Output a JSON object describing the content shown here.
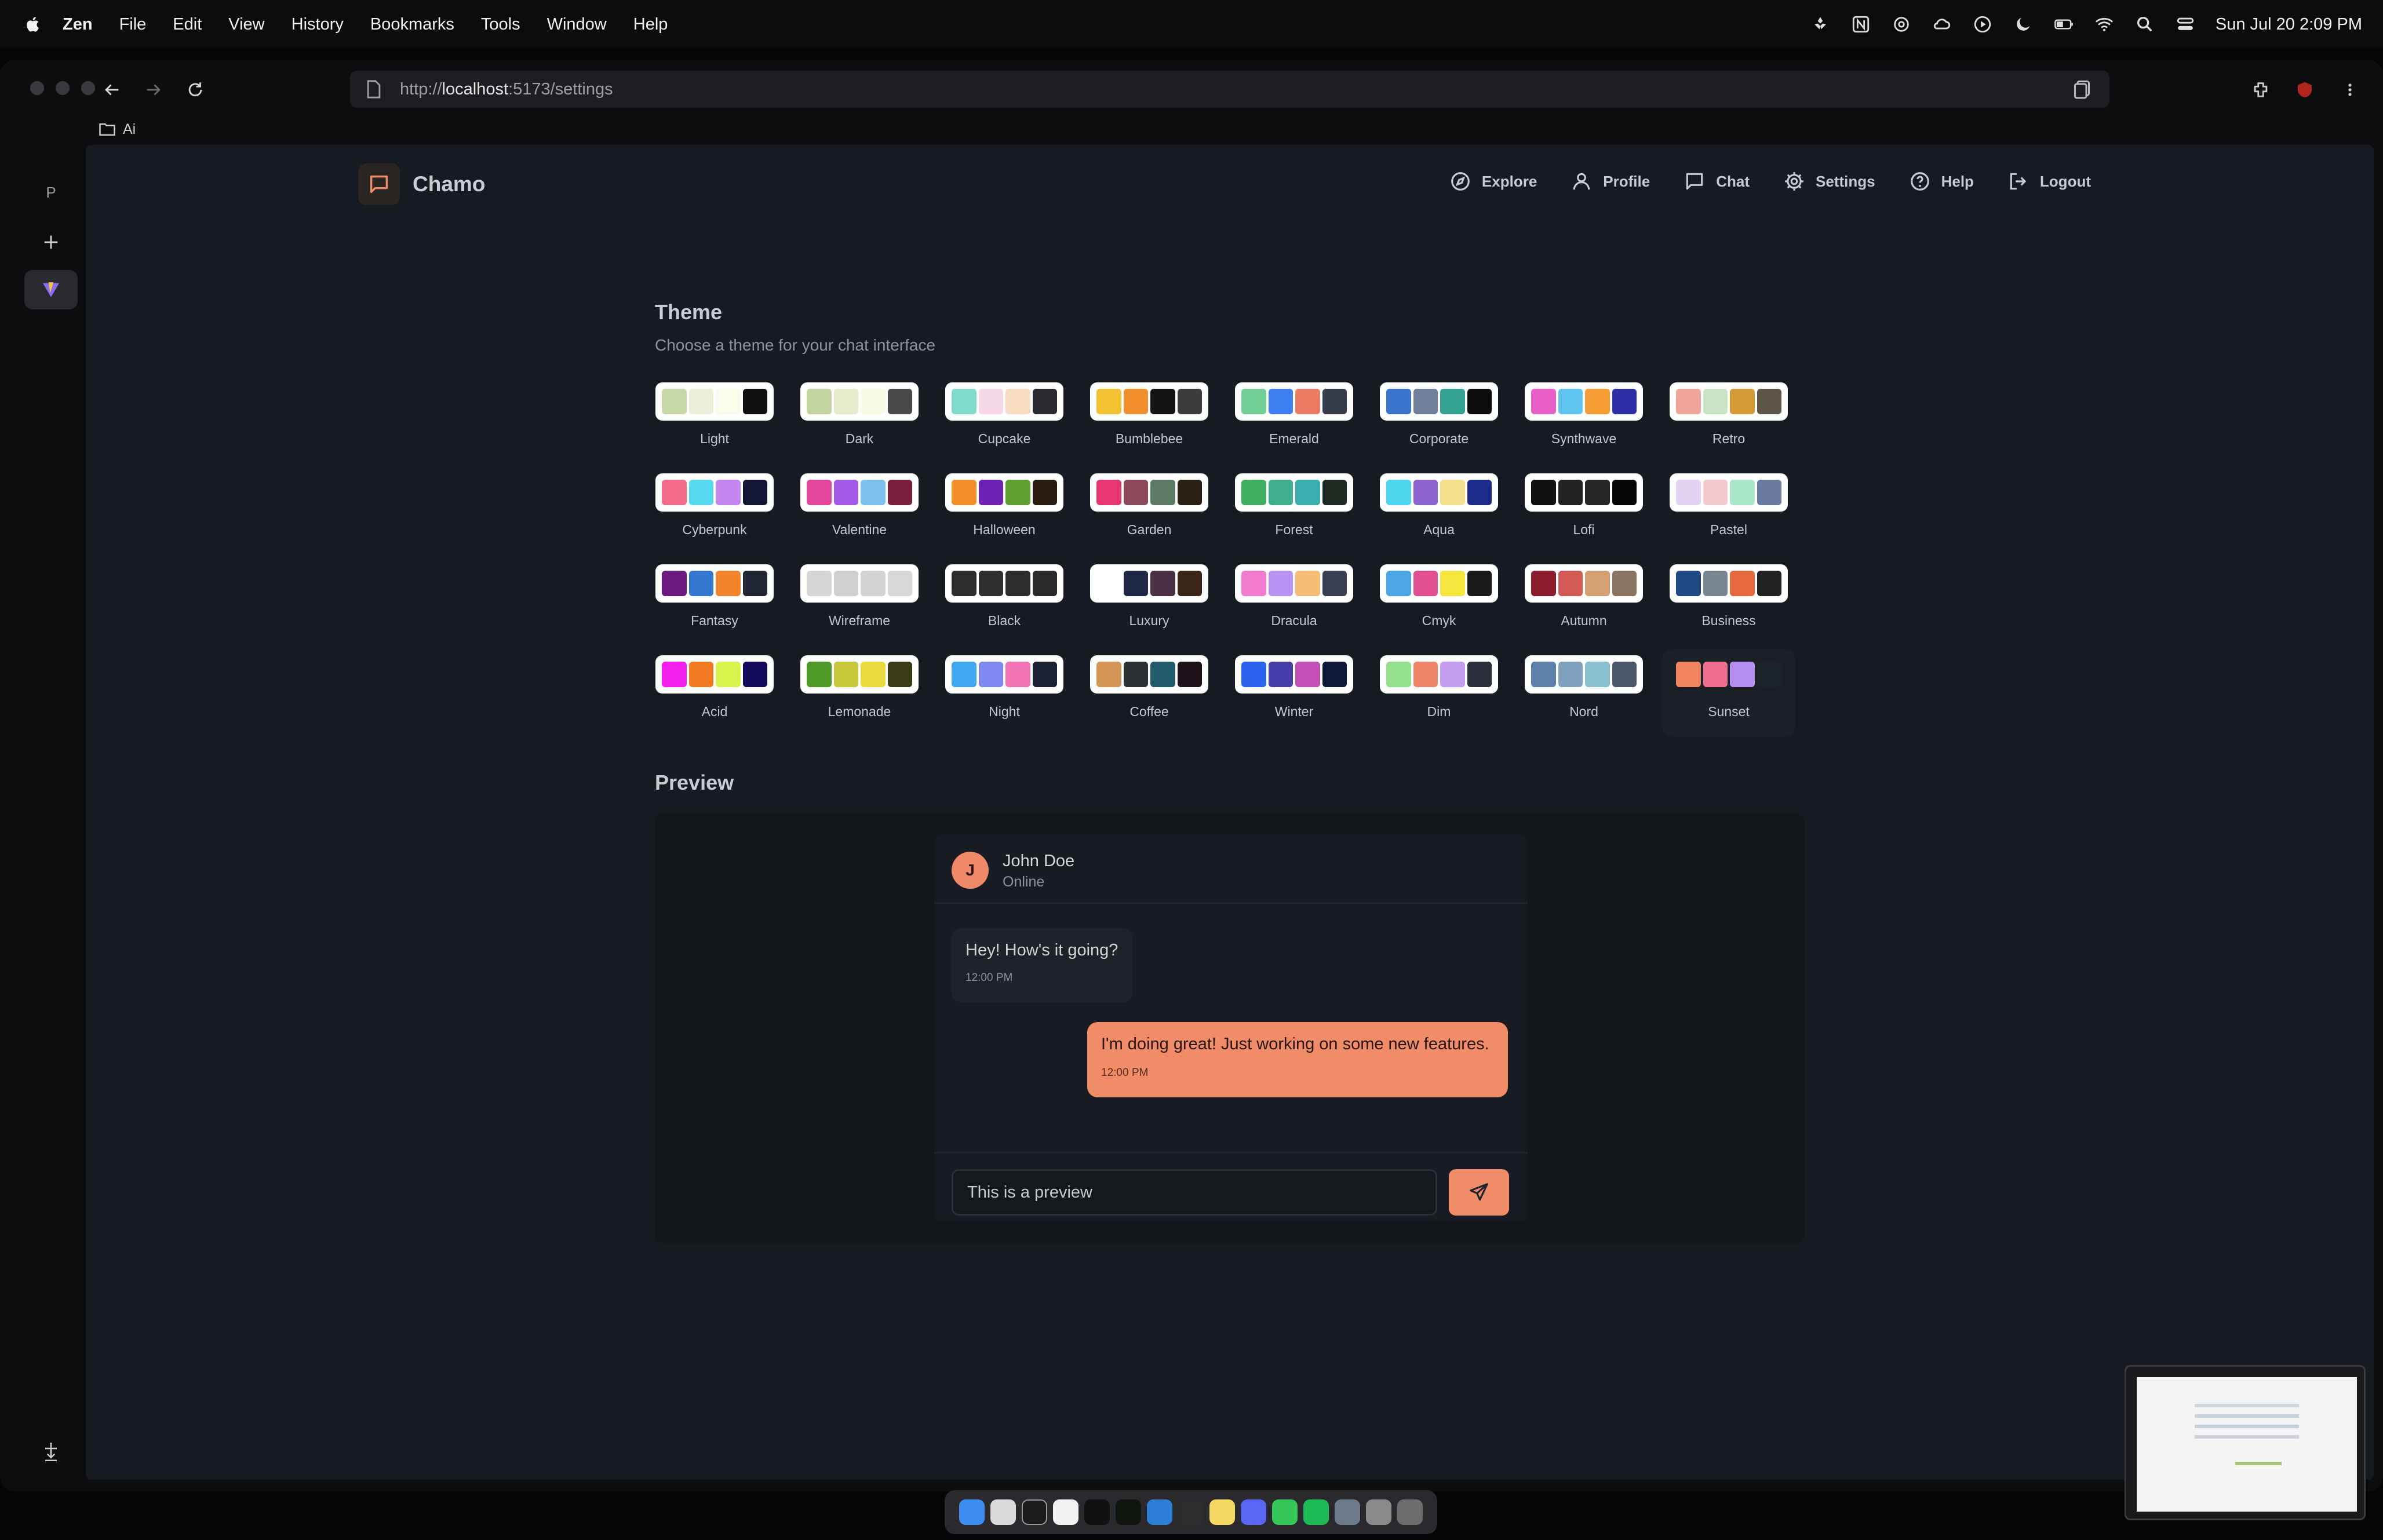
{
  "menubar": {
    "app": "Zen",
    "items": [
      "File",
      "Edit",
      "View",
      "History",
      "Bookmarks",
      "Tools",
      "Window",
      "Help"
    ],
    "clock": "Sun Jul 20  2:09 PM"
  },
  "browser": {
    "url_prefix": "http://",
    "url_host": "localhost",
    "url_path": ":5173/settings",
    "bookmark": "Ai",
    "strip_letter": "P"
  },
  "app": {
    "brand": "Chamo",
    "nav": [
      {
        "label": "Explore",
        "icon": "compass-icon"
      },
      {
        "label": "Profile",
        "icon": "user-icon"
      },
      {
        "label": "Chat",
        "icon": "chat-icon"
      },
      {
        "label": "Settings",
        "icon": "gear-icon"
      },
      {
        "label": "Help",
        "icon": "help-icon"
      },
      {
        "label": "Logout",
        "icon": "logout-icon"
      }
    ]
  },
  "theme": {
    "title": "Theme",
    "subtitle": "Choose a theme for your chat interface",
    "selected": "Sunset",
    "themes": [
      {
        "name": "Light",
        "colors": [
          "#c7d9a6",
          "#e9efd9",
          "#f7fbe9",
          "#111111"
        ]
      },
      {
        "name": "Dark",
        "colors": [
          "#c3d4a0",
          "#e3ebcb",
          "#f7fae4",
          "#4a4a4a"
        ]
      },
      {
        "name": "Cupcake",
        "colors": [
          "#7fdccb",
          "#f6d7e6",
          "#f8dcbf",
          "#2b2b2f"
        ]
      },
      {
        "name": "Bumblebee",
        "colors": [
          "#f2c132",
          "#f08f2c",
          "#141414",
          "#3c3c3c"
        ]
      },
      {
        "name": "Emerald",
        "colors": [
          "#6fcf94",
          "#3d7ff0",
          "#ec7b61",
          "#343b4a"
        ]
      },
      {
        "name": "Corporate",
        "colors": [
          "#3b74cf",
          "#6f7f97",
          "#34a290",
          "#0c0c0c"
        ]
      },
      {
        "name": "Synthwave",
        "colors": [
          "#ea5fc7",
          "#5fc3f2",
          "#f39d34",
          "#2c2fa8"
        ]
      },
      {
        "name": "Retro",
        "colors": [
          "#f0a49a",
          "#c9e3c4",
          "#d49933",
          "#5d5647"
        ]
      },
      {
        "name": "Cyberpunk",
        "colors": [
          "#f36c8a",
          "#57d9ef",
          "#c585ee",
          "#121633"
        ]
      },
      {
        "name": "Valentine",
        "colors": [
          "#e1479b",
          "#a45ae8",
          "#7fc1ee",
          "#7a1e3d"
        ]
      },
      {
        "name": "Halloween",
        "colors": [
          "#f28f2a",
          "#6f22b3",
          "#5f9f30",
          "#2b1c12"
        ]
      },
      {
        "name": "Garden",
        "colors": [
          "#e63571",
          "#8a4a5a",
          "#5d7a64",
          "#2a2013"
        ]
      },
      {
        "name": "Forest",
        "colors": [
          "#3fae5f",
          "#3fae8c",
          "#3aaeae",
          "#1f2a22"
        ]
      },
      {
        "name": "Aqua",
        "colors": [
          "#4ed6ee",
          "#8e63cf",
          "#f4e08c",
          "#1c2a8a"
        ]
      },
      {
        "name": "Lofi",
        "colors": [
          "#111111",
          "#222222",
          "#262626",
          "#050505"
        ]
      },
      {
        "name": "Pastel",
        "colors": [
          "#e4d2f5",
          "#f4c8cf",
          "#a9e6ca",
          "#6b7aa0"
        ]
      },
      {
        "name": "Fantasy",
        "colors": [
          "#6b1a80",
          "#3478d1",
          "#f2842d",
          "#1f2533"
        ]
      },
      {
        "name": "Wireframe",
        "colors": [
          "#d6d6d6",
          "#d0d0d0",
          "#d3d3d3",
          "#d8d8d8"
        ]
      },
      {
        "name": "Black",
        "colors": [
          "#2e2e2e",
          "#303030",
          "#2c2c2c",
          "#2a2a2a"
        ]
      },
      {
        "name": "Luxury",
        "colors": [
          "#ffffff",
          "#1e2844",
          "#4b2f45",
          "#3a2618"
        ]
      },
      {
        "name": "Dracula",
        "colors": [
          "#f07bcf",
          "#b993f2",
          "#f4bd76",
          "#3a3e52"
        ]
      },
      {
        "name": "Cmyk",
        "colors": [
          "#4aa6e4",
          "#e2508f",
          "#f5e53f",
          "#1a1a1a"
        ]
      },
      {
        "name": "Autumn",
        "colors": [
          "#8c1d2c",
          "#d35a54",
          "#d3a071",
          "#8a735f"
        ]
      },
      {
        "name": "Business",
        "colors": [
          "#1e4a83",
          "#7a8593",
          "#e4693f",
          "#222222"
        ]
      },
      {
        "name": "Acid",
        "colors": [
          "#f51ff0",
          "#f17a23",
          "#d8f34b",
          "#130a5c"
        ]
      },
      {
        "name": "Lemonade",
        "colors": [
          "#4e9a28",
          "#c6c639",
          "#ecd93d",
          "#3a3a16"
        ]
      },
      {
        "name": "Night",
        "colors": [
          "#3fa8f1",
          "#7e86ef",
          "#f271b3",
          "#1b2133"
        ]
      },
      {
        "name": "Coffee",
        "colors": [
          "#d49555",
          "#2b3135",
          "#225b6b",
          "#1c1219"
        ]
      },
      {
        "name": "Winter",
        "colors": [
          "#2b63ee",
          "#463ea8",
          "#c24fb6",
          "#0c1838"
        ]
      },
      {
        "name": "Dim",
        "colors": [
          "#93e08e",
          "#f1856a",
          "#c69cf0",
          "#2a2f3b"
        ]
      },
      {
        "name": "Nord",
        "colors": [
          "#5e81ac",
          "#81a1c1",
          "#88c0d0",
          "#4c566a"
        ]
      },
      {
        "name": "Sunset",
        "colors": [
          "#f08461",
          "#ef6d8e",
          "#b48ff0",
          "#1d232a"
        ]
      }
    ]
  },
  "preview": {
    "title": "Preview",
    "contact": {
      "initial": "J",
      "name": "John Doe",
      "status": "Online"
    },
    "incoming": {
      "text": "Hey! How's it going?",
      "time": "12:00 PM"
    },
    "outgoing": {
      "text": "I'm doing great! Just working on some new features.",
      "time": "12:00 PM"
    },
    "input_value": "This is a preview"
  },
  "colors": {
    "accent": "#f08d68",
    "page_bg": "#161b21"
  }
}
